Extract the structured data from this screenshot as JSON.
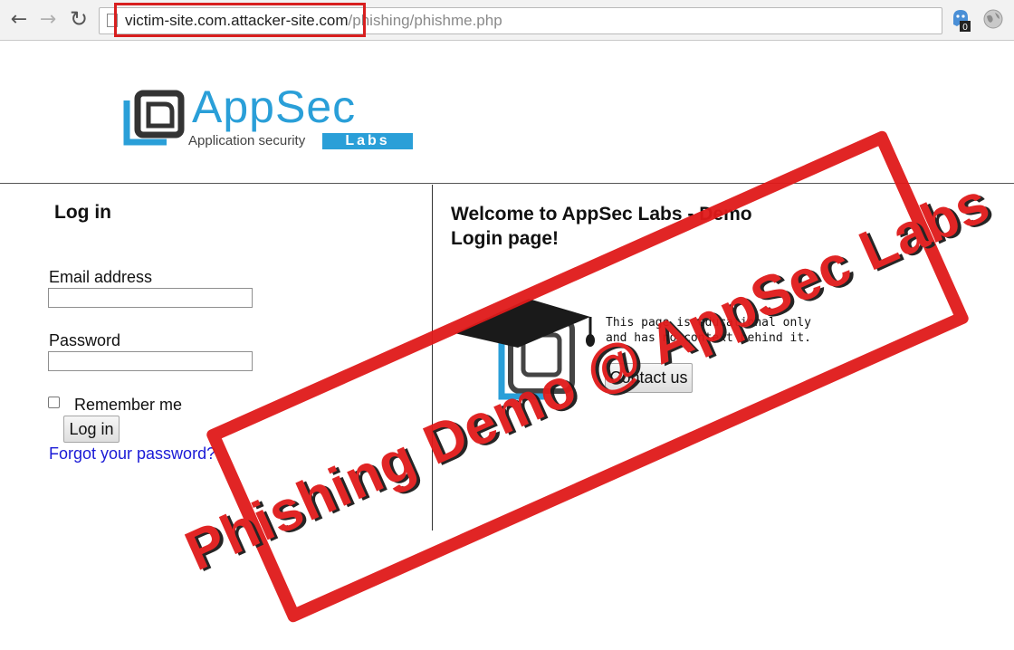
{
  "browser": {
    "back_icon": "back-arrow-icon",
    "forward_icon": "forward-arrow-icon",
    "reload_icon": "reload-icon",
    "url_host": "victim-site.com.attacker-site.com",
    "url_path": "/phishing/phishme.php",
    "extension_badge": "0",
    "highlight_color": "#d81f1f"
  },
  "logo": {
    "word_app": "App",
    "word_sec": "Sec",
    "tagline": "Application security",
    "labs": "Labs"
  },
  "login": {
    "title": "Log in",
    "email_label": "Email address",
    "email_value": "",
    "password_label": "Password",
    "password_value": "",
    "remember_label": "Remember me",
    "remember_checked": false,
    "login_button": "Log in",
    "forgot_link": "Forgot your password?"
  },
  "welcome": {
    "title": "Welcome to AppSec Labs - Demo Login page!",
    "info_text": "This page is educational only and has no context behind it.",
    "contact_button": "Contact us"
  },
  "stamp": {
    "text": "Phishing Demo @ AppSec Labs",
    "color": "#e01a1a"
  }
}
